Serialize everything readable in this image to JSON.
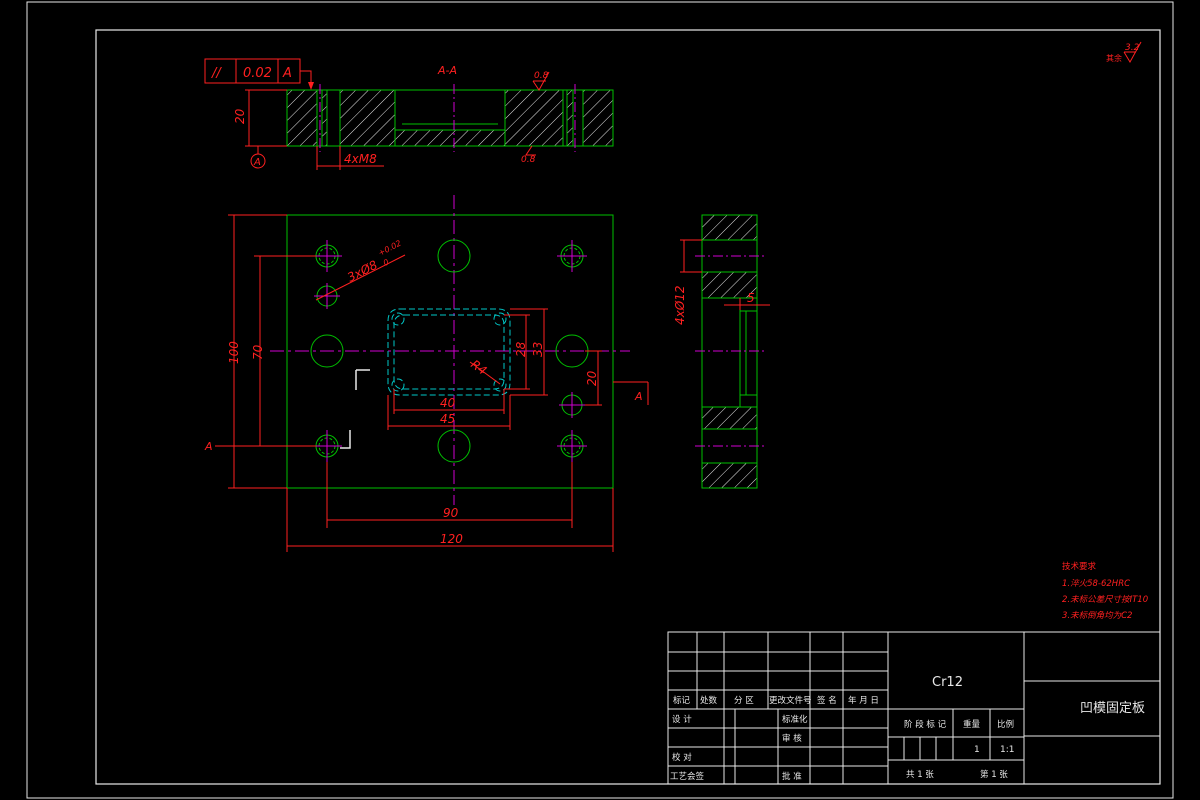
{
  "title_block": {
    "material": "Cr12",
    "part_name": "凹模固定板",
    "headers": [
      "标记",
      "处数",
      "分 区",
      "更改文件号",
      "签 名",
      "年 月 日"
    ],
    "design": "设 计",
    "standardization": "标准化",
    "check": "校 对",
    "review": "审 核",
    "process": "工艺会签",
    "approve": "批 准",
    "stage_mark": "阶 段 标 记",
    "weight": "重量",
    "scale_label": "比例",
    "quantity": "1",
    "scale": "1:1",
    "sheets_total": "共 1 张",
    "sheet_no": "第 1 张"
  },
  "tech_requirements": {
    "title": "技术要求",
    "items": [
      "1.淬火58-62HRC",
      "2.未标公差尺寸按IT10",
      "3.未标倒角均为C2"
    ]
  },
  "roughness": {
    "corner_value": "3.2",
    "corner_label": "其余",
    "top_value": "0.8",
    "bottom_value": "0.8"
  },
  "tolerance_frame": {
    "symbol": "//",
    "value": "0.02",
    "datum": "A"
  },
  "section": {
    "title": "A-A",
    "datum_label": "A",
    "thickness": "20",
    "thread_callout": "4xM8"
  },
  "plan_view": {
    "dims": {
      "height_total": "100",
      "height_hole": "70",
      "width_hole": "90",
      "width_total": "120",
      "opening_w1": "40",
      "opening_w2": "45",
      "opening_h1": "28",
      "opening_h2": "33",
      "offset_20": "20",
      "corner_radius": "R4",
      "pin_holes": "3xØ8",
      "pin_tol_upper": "+0.02",
      "pin_tol_lower": "0"
    },
    "section_marker_left": "A",
    "section_marker_right": "A"
  },
  "side_view": {
    "hole_callout": "4xØ12",
    "step_depth": "5"
  }
}
